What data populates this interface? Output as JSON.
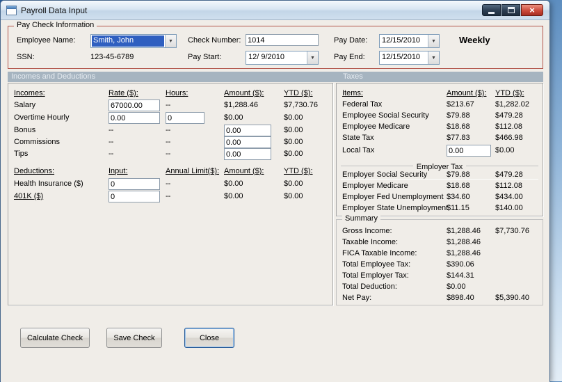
{
  "window": {
    "title": "Payroll Data Input"
  },
  "icons": {
    "dropdown_arrow": "▼",
    "close": "×"
  },
  "paycheck": {
    "group_label": "Pay Check Information",
    "fields": {
      "employee_name": {
        "label": "Employee Name:",
        "value": "Smith, John"
      },
      "ssn": {
        "label": "SSN:",
        "value": "123-45-6789"
      },
      "check_number": {
        "label": "Check Number:",
        "value": "1014"
      },
      "pay_start": {
        "label": "Pay Start:",
        "value": "12/ 9/2010"
      },
      "pay_date": {
        "label": "Pay Date:",
        "value": "12/15/2010"
      },
      "pay_end": {
        "label": "Pay End:",
        "value": "12/15/2010"
      }
    },
    "frequency": "Weekly"
  },
  "section_headers": {
    "incomes": "Incomes and Deductions",
    "taxes": "Taxes"
  },
  "incomes": {
    "headers": {
      "name": "Incomes:",
      "rate": "Rate ($):",
      "hours": "Hours:",
      "amount": "Amount ($):",
      "ytd": "YTD ($):"
    },
    "rows": [
      {
        "name": "Salary",
        "rate_input": "67000.00",
        "hours": "--",
        "amount": "$1,288.46",
        "ytd": "$7,730.76"
      },
      {
        "name": "Overtime Hourly",
        "rate_input": "0.00",
        "hours_input": "0",
        "amount": "$0.00",
        "ytd": "$0.00"
      },
      {
        "name": "Bonus",
        "rate": "--",
        "hours": "--",
        "amount_input": "0.00",
        "ytd": "$0.00"
      },
      {
        "name": "Commissions",
        "rate": "--",
        "hours": "--",
        "amount_input": "0.00",
        "ytd": "$0.00"
      },
      {
        "name": "Tips",
        "rate": "--",
        "hours": "--",
        "amount_input": "0.00",
        "ytd": "$0.00"
      }
    ]
  },
  "deductions": {
    "headers": {
      "name": "Deductions:",
      "input": "Input:",
      "limit": "Annual Limit($):",
      "amount": "Amount ($):",
      "ytd": "YTD ($):"
    },
    "rows": [
      {
        "name": "Health Insurance ($)",
        "input": "0",
        "limit": "--",
        "amount": "$0.00",
        "ytd": "$0.00"
      },
      {
        "name": "401K ($)",
        "input": "0",
        "limit": "--",
        "amount": "$0.00",
        "ytd": "$0.00"
      }
    ]
  },
  "taxes": {
    "headers": {
      "name": "Items:",
      "amount": "Amount ($):",
      "ytd": "YTD ($):"
    },
    "employee_rows": [
      {
        "name": "Federal Tax",
        "amount": "$213.67",
        "ytd": "$1,282.02"
      },
      {
        "name": "Employee Social Security",
        "amount": "$79.88",
        "ytd": "$479.28"
      },
      {
        "name": "Employee Medicare",
        "amount": "$18.68",
        "ytd": "$112.08"
      },
      {
        "name": "State Tax",
        "amount": "$77.83",
        "ytd": "$466.98"
      }
    ],
    "local_tax": {
      "name": "Local Tax",
      "amount_input": "0.00",
      "ytd": "$0.00"
    },
    "employer_group_label": "Employer Tax",
    "employer_rows": [
      {
        "name": "Employer Social Security",
        "amount": "$79.88",
        "ytd": "$479.28"
      },
      {
        "name": "Employer Medicare",
        "amount": "$18.68",
        "ytd": "$112.08"
      },
      {
        "name": "Employer Fed Unemployment",
        "amount": "$34.60",
        "ytd": "$434.00"
      },
      {
        "name": "Employer State Unemployment",
        "amount": "$11.15",
        "ytd": "$140.00"
      }
    ]
  },
  "summary": {
    "group_label": "Summary",
    "rows": [
      {
        "name": "Gross Income:",
        "amount": "$1,288.46",
        "ytd": "$7,730.76"
      },
      {
        "name": "Taxable Income:",
        "amount": "$1,288.46",
        "ytd": ""
      },
      {
        "name": "FICA Taxable Income:",
        "amount": "$1,288.46",
        "ytd": ""
      },
      {
        "name": "Total Employee Tax:",
        "amount": "$390.06",
        "ytd": ""
      },
      {
        "name": "Total Employer Tax:",
        "amount": "$144.31",
        "ytd": ""
      },
      {
        "name": "Total Deduction:",
        "amount": "$0.00",
        "ytd": ""
      },
      {
        "name": "Net Pay:",
        "amount": "$898.40",
        "ytd": "$5,390.40"
      }
    ]
  },
  "buttons": {
    "calculate": "Calculate Check",
    "save": "Save Check",
    "close": "Close"
  }
}
